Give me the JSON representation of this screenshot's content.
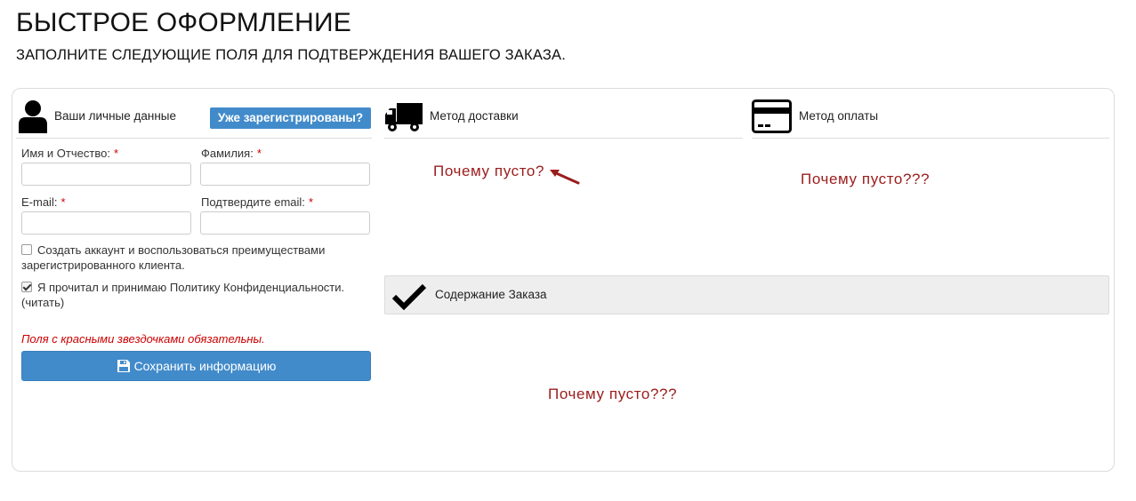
{
  "page": {
    "title": "БЫСТРОЕ ОФОРМЛЕНИЕ",
    "subtitle": "ЗАПОЛНИТЕ СЛЕДУЮЩИЕ ПОЛЯ ДЛЯ ПОДТВЕРЖДЕНИЯ ВАШЕГО ЗАКАЗА."
  },
  "personal": {
    "heading": "Ваши личные данные",
    "icon": "user-icon",
    "login_button": "Уже зарегистрированы?",
    "fields": {
      "first_name_label": "Имя и Отчество:",
      "last_name_label": "Фамилия:",
      "email_label": "E-mail:",
      "confirm_email_label": "Подтвердите email:",
      "required_mark": "*"
    },
    "create_account": {
      "checked": false,
      "line1": "Создать аккаунт и воспользоваться преимуществами",
      "line2": "зарегистрированного клиента."
    },
    "privacy": {
      "checked": true,
      "line1": "Я прочитал и принимаю Политику Конфиденциальности.",
      "line2": "(читать)"
    },
    "required_note": "Поля с красными звездочками обязательны.",
    "save_button": "Сохранить информацию"
  },
  "shipping": {
    "heading": "Метод доставки",
    "icon": "truck-icon"
  },
  "payment": {
    "heading": "Метод оплаты",
    "icon": "credit-card-icon"
  },
  "order": {
    "heading": "Содержание Заказа",
    "icon": "checkmark-icon"
  },
  "annotations": {
    "shipping_empty": "Почему пусто?",
    "payment_empty": "Почему пусто???",
    "order_empty": "Почему пусто???"
  },
  "colors": {
    "primary_button": "#428bca",
    "required": "#cc0000",
    "annotation": "#9b1c1c",
    "order_bar_bg": "#eeeeee"
  }
}
